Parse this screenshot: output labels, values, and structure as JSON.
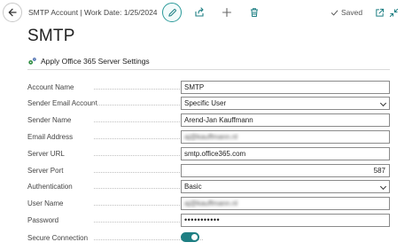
{
  "header": {
    "title": "SMTP Account | Work Date: 1/25/2024",
    "status": "Saved"
  },
  "page": {
    "title": "SMTP"
  },
  "actions": {
    "apply_label": "Apply Office 365 Server Settings"
  },
  "fields": {
    "account_name": {
      "label": "Account Name",
      "value": "SMTP"
    },
    "sender_email_account": {
      "label": "Sender Email Account",
      "value": "Specific User"
    },
    "sender_name": {
      "label": "Sender Name",
      "value": "Arend-Jan Kauffmann"
    },
    "email_address": {
      "label": "Email Address",
      "value": "aj@kauffmann.nl"
    },
    "server_url": {
      "label": "Server URL",
      "value": "smtp.office365.com"
    },
    "server_port": {
      "label": "Server Port",
      "value": "587"
    },
    "authentication": {
      "label": "Authentication",
      "value": "Basic"
    },
    "user_name": {
      "label": "User Name",
      "value": "aj@kauffmann.nl"
    },
    "password": {
      "label": "Password",
      "value": "•••••••••••"
    },
    "secure_connection": {
      "label": "Secure Connection",
      "value": true
    }
  },
  "colors": {
    "accent": "#1e7f83",
    "apply_icon": "#2b8a3e"
  },
  "icons": {
    "back": "back-arrow-icon",
    "edit": "pencil-icon",
    "share": "share-icon",
    "new": "plus-icon",
    "delete": "trash-icon",
    "saved": "checkmark-icon",
    "open_new": "open-in-new-window-icon",
    "collapse": "collapse-icon",
    "apply": "gears-icon"
  }
}
